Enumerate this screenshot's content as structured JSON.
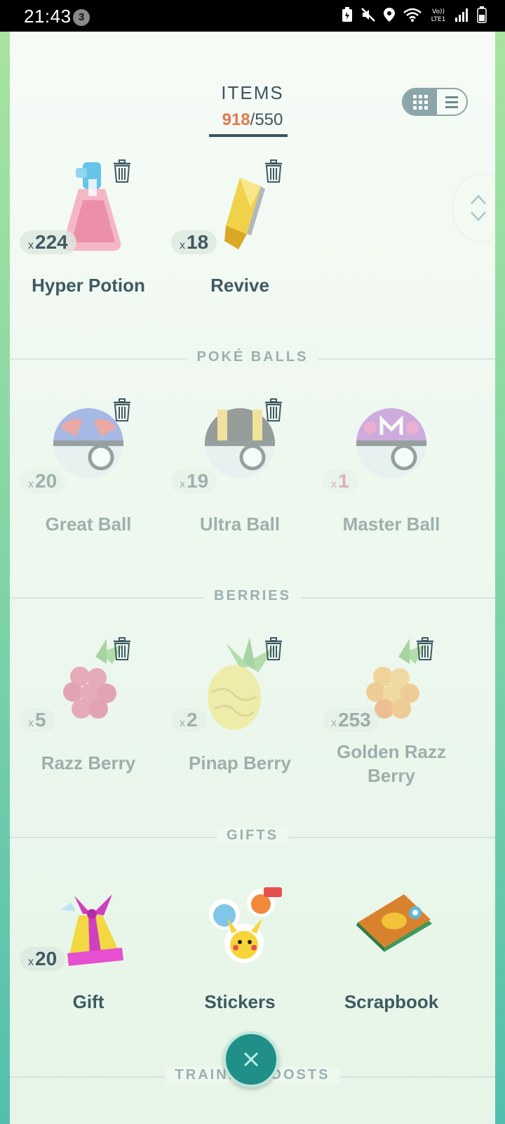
{
  "status_bar": {
    "time": "21:43",
    "notification_count": "3",
    "icons": [
      "battery-saver-icon",
      "mute-icon",
      "location-icon",
      "wifi-icon",
      "volte-icon",
      "signal-icon",
      "battery-icon"
    ]
  },
  "header": {
    "title": "ITEMS",
    "used": "918",
    "separator": "/",
    "capacity": "550",
    "view_modes": [
      "grid-view-icon",
      "list-view-icon"
    ],
    "active_view": "grid"
  },
  "sections": [
    {
      "label": "",
      "items": [
        {
          "name": "Hyper Potion",
          "qty_prefix": "x",
          "qty": "224"
        },
        {
          "name": "Revive",
          "qty_prefix": "x",
          "qty": "18"
        }
      ]
    },
    {
      "label": "POKÉ BALLS",
      "items": [
        {
          "name": "Great Ball",
          "qty_prefix": "x",
          "qty": "20"
        },
        {
          "name": "Ultra Ball",
          "qty_prefix": "x",
          "qty": "19"
        },
        {
          "name": "Master Ball",
          "qty_prefix": "x",
          "qty": "1"
        }
      ]
    },
    {
      "label": "BERRIES",
      "items": [
        {
          "name": "Razz Berry",
          "qty_prefix": "x",
          "qty": "5"
        },
        {
          "name": "Pinap Berry",
          "qty_prefix": "x",
          "qty": "2"
        },
        {
          "name_line1": "Golden Razz",
          "name_line2": "Berry",
          "qty_prefix": "x",
          "qty": "253"
        }
      ]
    },
    {
      "label": "GIFTS",
      "items": [
        {
          "name": "Gift",
          "qty_prefix": "x",
          "qty": "20"
        },
        {
          "name": "Stickers"
        },
        {
          "name": "Scrapbook"
        }
      ]
    },
    {
      "label": "TRAINER BOOSTS"
    }
  ],
  "colors": {
    "accent_orange": "#e07a4c",
    "text_dark": "#3b5560",
    "close_button": "#1f8f87"
  }
}
